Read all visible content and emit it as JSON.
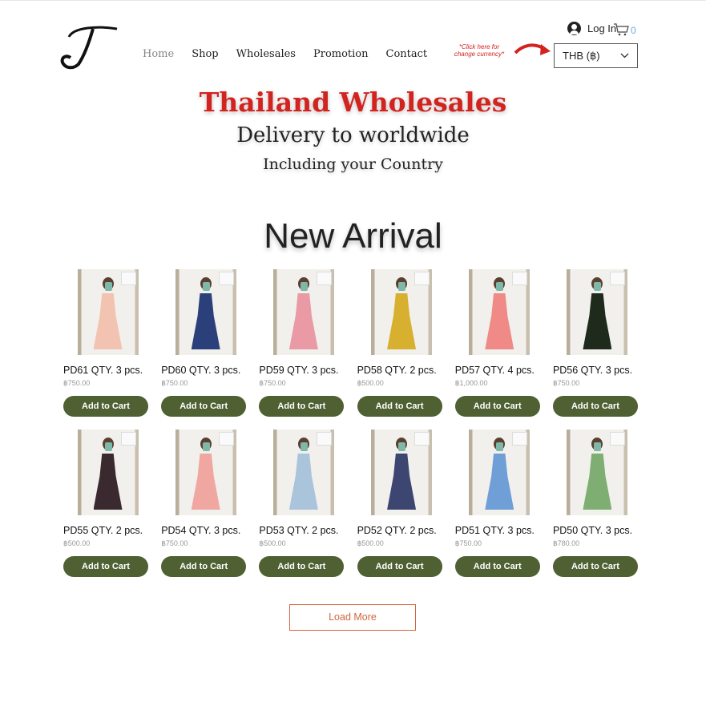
{
  "header": {
    "logo_letter": "T",
    "nav": [
      "Home",
      "Shop",
      "Wholesales",
      "Promotion",
      "Contact"
    ],
    "active_nav": "Home",
    "login_label": "Log In",
    "cart_count": "0",
    "currency_hint": "*Click here for change currency*",
    "currency_value": "THB (฿)"
  },
  "hero": {
    "title": "Thailand Wholesales",
    "subtitle": "Delivery to worldwide",
    "subtitle2": "Including your Country"
  },
  "section": {
    "title": "New Arrival"
  },
  "products": [
    {
      "name": "PD61 QTY. 3 pcs.",
      "price": "฿750.00",
      "dress_color": "#f2c3b0"
    },
    {
      "name": "PD60 QTY. 3 pcs.",
      "price": "฿750.00",
      "dress_color": "#2b3f7a"
    },
    {
      "name": "PD59 QTY. 3 pcs.",
      "price": "฿750.00",
      "dress_color": "#e99aa4"
    },
    {
      "name": "PD58 QTY. 2 pcs.",
      "price": "฿500.00",
      "dress_color": "#d7b02f"
    },
    {
      "name": "PD57 QTY. 4 pcs.",
      "price": "฿1,000.00",
      "dress_color": "#ef8a87"
    },
    {
      "name": "PD56 QTY. 3 pcs.",
      "price": "฿750.00",
      "dress_color": "#1e2a1c"
    },
    {
      "name": "PD55 QTY. 2 pcs.",
      "price": "฿500.00",
      "dress_color": "#3a2a30"
    },
    {
      "name": "PD54 QTY. 3 pcs.",
      "price": "฿750.00",
      "dress_color": "#f1a7a1"
    },
    {
      "name": "PD53 QTY. 2 pcs.",
      "price": "฿500.00",
      "dress_color": "#aac4dc"
    },
    {
      "name": "PD52 QTY. 2 pcs.",
      "price": "฿500.00",
      "dress_color": "#3c4670"
    },
    {
      "name": "PD51 QTY. 3 pcs.",
      "price": "฿750.00",
      "dress_color": "#6f9fd6"
    },
    {
      "name": "PD50 QTY. 3 pcs.",
      "price": "฿780.00",
      "dress_color": "#7fae72"
    }
  ],
  "add_to_cart_label": "Add to Cart",
  "load_more_label": "Load More",
  "colors": {
    "accent_button": "#4f6033",
    "hero_red": "#d2231f",
    "load_more": "#d2663c"
  }
}
